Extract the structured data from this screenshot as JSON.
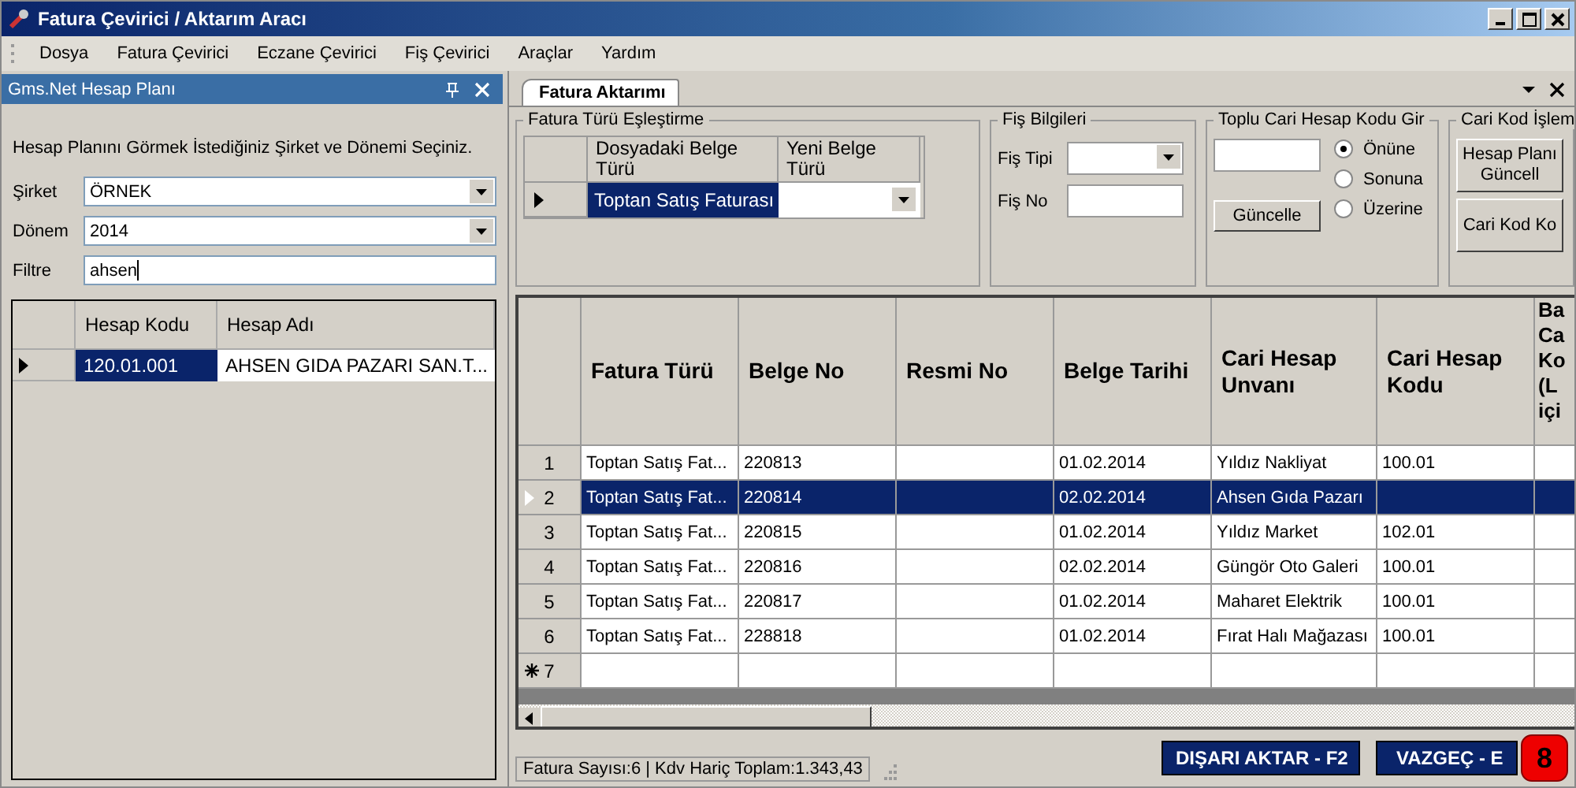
{
  "window": {
    "title": "Fatura Çevirici / Aktarım Aracı"
  },
  "menu": [
    {
      "label": "Dosya"
    },
    {
      "label": "Fatura Çevirici"
    },
    {
      "label": "Eczane Çevirici"
    },
    {
      "label": "Fiş Çevirici"
    },
    {
      "label": "Araçlar"
    },
    {
      "label": "Yardım"
    }
  ],
  "left_panel": {
    "title": "Gms.Net Hesap Planı",
    "instruction": "Hesap Planını Görmek İstediğiniz Şirket ve Dönemi Seçiniz.",
    "fields": [
      {
        "label": "Şirket",
        "value": "ÖRNEK",
        "kind": "combo"
      },
      {
        "label": "Dönem",
        "value": "2014",
        "kind": "combo"
      },
      {
        "label": "Filtre",
        "value": "ahsen",
        "kind": "text"
      }
    ],
    "table": {
      "columns": [
        "Hesap Kodu",
        "Hesap Adı"
      ],
      "rows": [
        {
          "cells": [
            "120.01.001",
            "AHSEN GIDA PAZARI SAN.T..."
          ],
          "selected": true
        }
      ]
    }
  },
  "tab": {
    "label": "Fatura Aktarımı",
    "selected": true
  },
  "mapping": {
    "title": "Fatura Türü Eşleştirme",
    "columns": [
      "Dosyadaki Belge Türü",
      "Yeni Belge Türü"
    ],
    "rows": [
      {
        "cells": [
          "Toptan Satış Faturası",
          ""
        ],
        "selected": true
      }
    ]
  },
  "fis": {
    "title": "Fiş Bilgileri",
    "fields": [
      {
        "label": "Fiş Tipi",
        "kind": "combo"
      },
      {
        "label": "Fiş No",
        "kind": "text"
      }
    ]
  },
  "toplu": {
    "title": "Toplu Cari Hesap Kodu Gir",
    "button": "Güncelle",
    "options": [
      {
        "label": "Önüne",
        "selected": true
      },
      {
        "label": "Sonuna",
        "selected": false
      },
      {
        "label": "Üzerine",
        "selected": false
      }
    ]
  },
  "cari": {
    "title": "Cari Kod İşlem",
    "buttons": [
      "Hesap Planı Güncell",
      "Cari Kod Ko"
    ]
  },
  "grid": {
    "columns": [
      "Fatura Türü",
      "Belge No",
      "Resmi No",
      "Belge Tarihi",
      "Cari Hesap Unvanı",
      "Cari Hesap Kodu",
      "Ba Ca Ko (L içi"
    ],
    "rows": [
      {
        "number": "1",
        "selected": false,
        "cells": [
          "Toptan Satış Fat...",
          "220813",
          "",
          "01.02.2014",
          "Yıldız Nakliyat",
          "100.01"
        ]
      },
      {
        "number": "2",
        "selected": true,
        "cells": [
          "Toptan Satış Fat...",
          "220814",
          "",
          "02.02.2014",
          "Ahsen Gıda Pazarı",
          ""
        ]
      },
      {
        "number": "3",
        "selected": false,
        "cells": [
          "Toptan Satış Fat...",
          "220815",
          "",
          "01.02.2014",
          "Yıldız Market",
          "102.01"
        ]
      },
      {
        "number": "4",
        "selected": false,
        "cells": [
          "Toptan Satış Fat...",
          "220816",
          "",
          "02.02.2014",
          "Güngör Oto Galeri",
          "100.01"
        ]
      },
      {
        "number": "5",
        "selected": false,
        "cells": [
          "Toptan Satış Fat...",
          "220817",
          "",
          "01.02.2014",
          "Maharet Elektrik",
          "100.01"
        ]
      },
      {
        "number": "6",
        "selected": false,
        "cells": [
          "Toptan Satış Fat...",
          "228818",
          "",
          "01.02.2014",
          "Fırat Halı Mağazası",
          "100.01"
        ]
      }
    ],
    "new_row_number": "7"
  },
  "status_bar": "Fatura Sayısı:6 | Kdv Hariç Toplam:1.343,43",
  "buttons": [
    "DIŞARI AKTAR - F2",
    "VAZGEÇ - E"
  ],
  "badge": "8"
}
